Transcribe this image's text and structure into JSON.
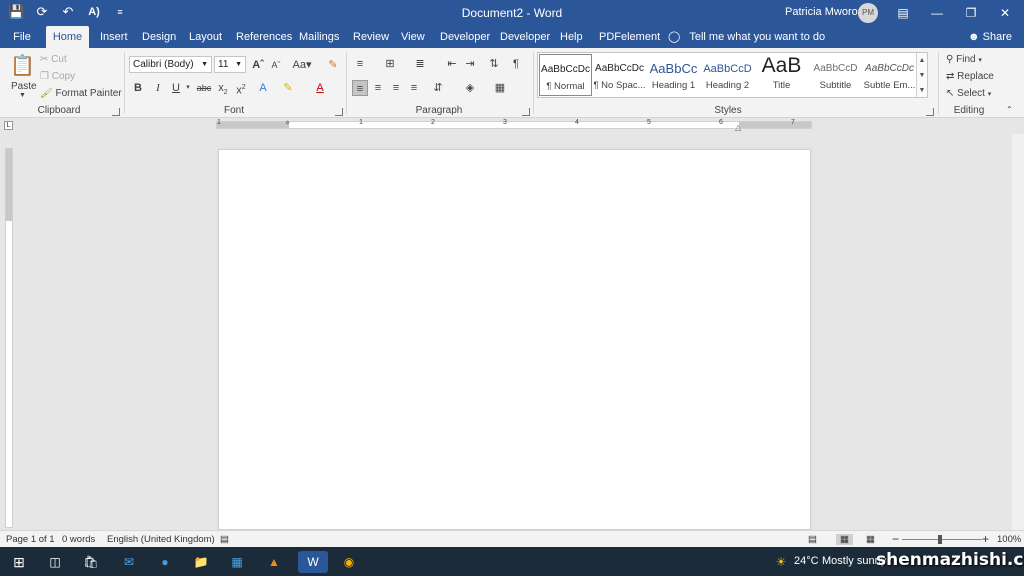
{
  "titlebar": {
    "document_title": "Document2 - Word",
    "user_name": "Patricia Mworozi",
    "user_initials": "PM",
    "qat_icons": [
      "save-icon",
      "autosave-icon",
      "undo-icon",
      "read-aloud-icon",
      "customize-qat-icon"
    ],
    "window_controls": [
      "ribbon-display-icon",
      "minimize-icon",
      "restore-icon",
      "close-icon"
    ]
  },
  "tabs": {
    "file": "File",
    "items": [
      "Home",
      "Insert",
      "Design",
      "Layout",
      "References",
      "Mailings",
      "Review",
      "View",
      "Developer",
      "Developer",
      "Help",
      "PDFelement"
    ],
    "active": "Home",
    "tell_me": "Tell me what you want to do",
    "share": "Share"
  },
  "clipboard": {
    "label": "Clipboard",
    "paste": "Paste",
    "cut": "Cut",
    "copy": "Copy",
    "format_painter": "Format Painter"
  },
  "font": {
    "label": "Font",
    "family": "Calibri (Body)",
    "size": "11"
  },
  "paragraph": {
    "label": "Paragraph"
  },
  "styles": {
    "label": "Styles",
    "items": [
      {
        "preview": "AaBbCcDc",
        "name": "¶ Normal"
      },
      {
        "preview": "AaBbCcDc",
        "name": "¶ No Spac..."
      },
      {
        "preview": "AaBbCc",
        "name": "Heading 1"
      },
      {
        "preview": "AaBbCcD",
        "name": "Heading 2"
      },
      {
        "preview": "AaB",
        "name": "Title"
      },
      {
        "preview": "AaBbCcD",
        "name": "Subtitle"
      },
      {
        "preview": "AaBbCcDc",
        "name": "Subtle Em..."
      }
    ]
  },
  "editing": {
    "label": "Editing",
    "find": "Find",
    "replace": "Replace",
    "select": "Select"
  },
  "ruler_numbers": [
    "1",
    "1",
    "2",
    "3",
    "4",
    "5",
    "6",
    "7"
  ],
  "statusbar": {
    "page": "Page 1 of 1",
    "words": "0 words",
    "language": "English (United Kingdom)",
    "zoom_minus": "−",
    "zoom_plus": "+",
    "zoom": "100%"
  },
  "taskbar": {
    "temperature": "24°C",
    "weather": "Mostly sunny",
    "watermark": "shenmazhishi.com"
  },
  "colors": {
    "accent": "#2b579a",
    "ribbon": "#f3f3f3",
    "canvas": "#e6e6e6"
  }
}
